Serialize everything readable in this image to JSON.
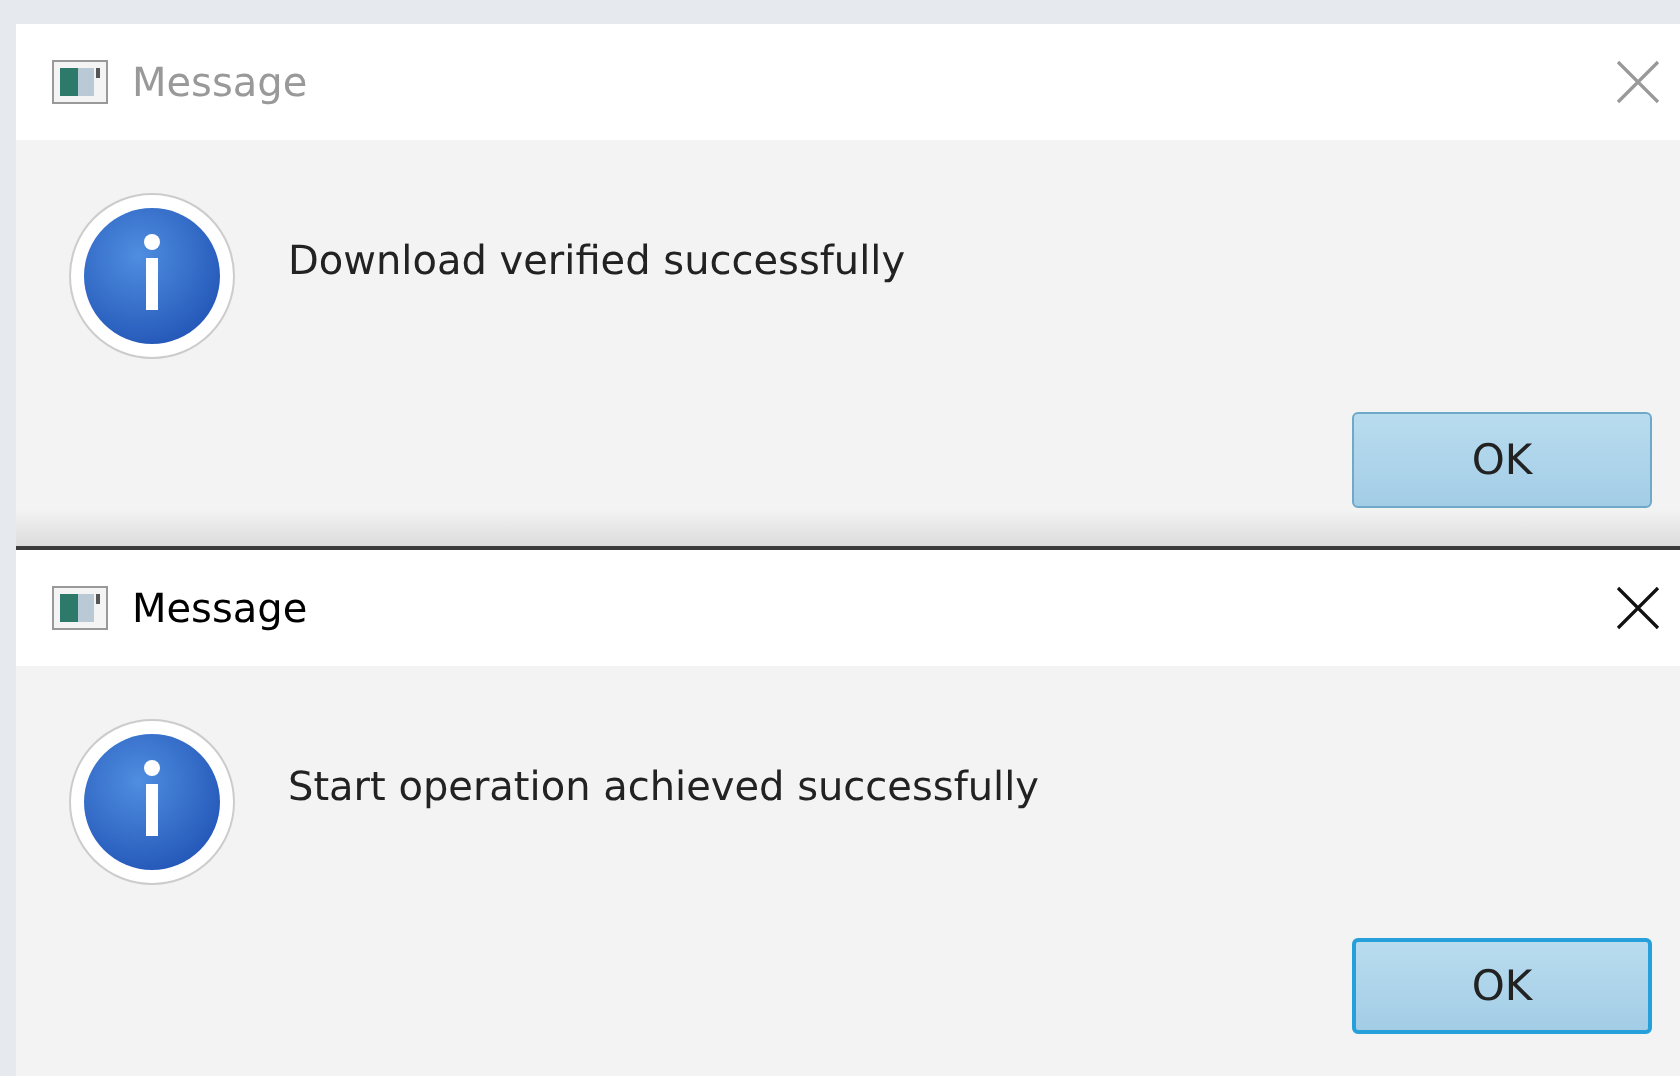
{
  "dialogs": [
    {
      "title": "Message",
      "active": false,
      "message": "Download verified successfully",
      "button": "OK"
    },
    {
      "title": "Message",
      "active": true,
      "message": "Start operation achieved successfully",
      "button": "OK"
    }
  ]
}
